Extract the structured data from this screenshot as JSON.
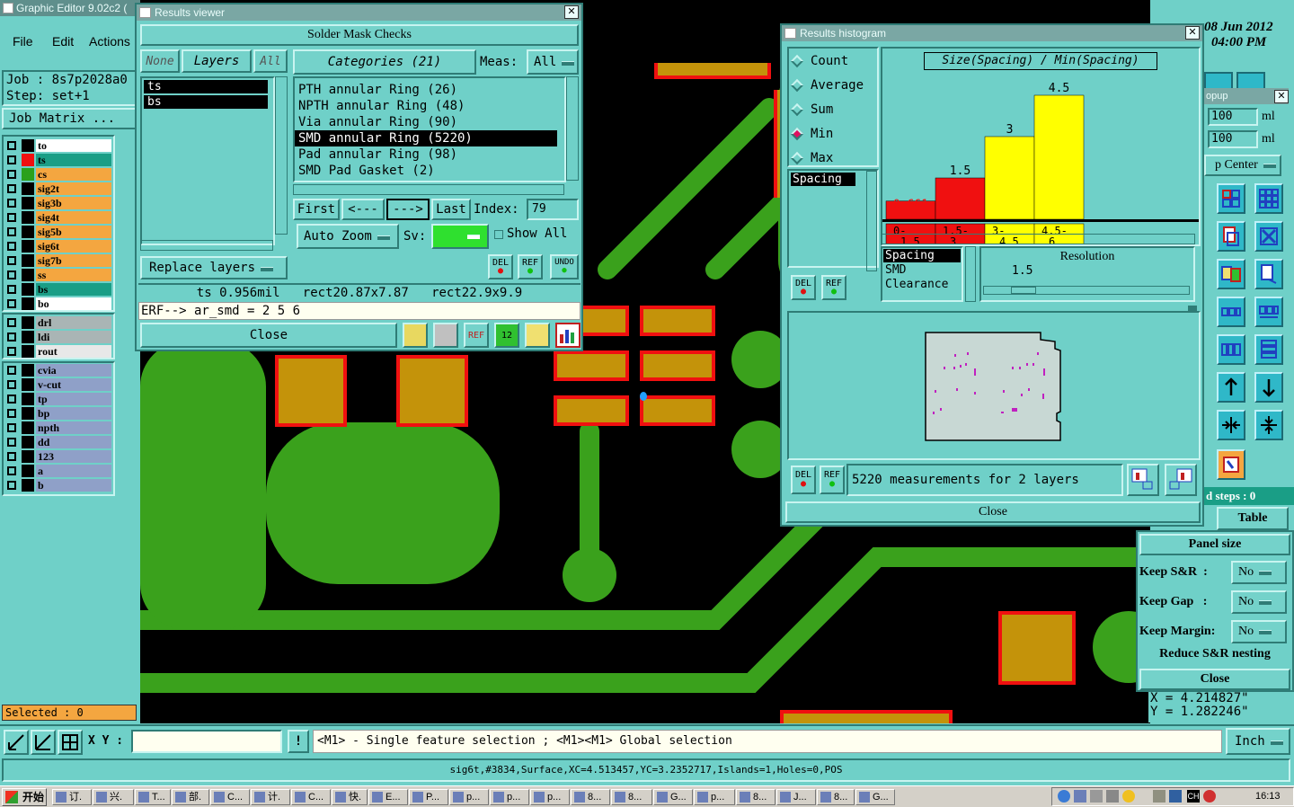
{
  "app": {
    "title": "Graphic Editor 9.02c2 (",
    "date": "08 Jun 2012",
    "time": "04:00 PM"
  },
  "menu": [
    "File",
    "Edit",
    "Actions"
  ],
  "job": {
    "job": "Job : 8s7p2028a0",
    "step": "Step: set+1",
    "matrix": "Job Matrix ..."
  },
  "layers": [
    {
      "name": "to",
      "color": "#ffffff",
      "swatch": "#000000"
    },
    {
      "name": "ts",
      "color": "#1a9e86",
      "swatch": "#f01010"
    },
    {
      "name": "cs",
      "color": "#f4a640",
      "swatch": "#2aa11c"
    },
    {
      "name": "sig2t",
      "color": "#f4a640",
      "swatch": "#000000"
    },
    {
      "name": "sig3b",
      "color": "#f4a640",
      "swatch": "#000000"
    },
    {
      "name": "sig4t",
      "color": "#f4a640",
      "swatch": "#000000"
    },
    {
      "name": "sig5b",
      "color": "#f4a640",
      "swatch": "#000000"
    },
    {
      "name": "sig6t",
      "color": "#f4a640",
      "swatch": "#000000"
    },
    {
      "name": "sig7b",
      "color": "#f4a640",
      "swatch": "#000000"
    },
    {
      "name": "ss",
      "color": "#f4a640",
      "swatch": "#000000"
    },
    {
      "name": "bs",
      "color": "#1a9e86",
      "swatch": "#000000"
    },
    {
      "name": "bo",
      "color": "#ffffff",
      "swatch": "#000000"
    }
  ],
  "layers2": [
    {
      "name": "drl",
      "color": "#a9b5b5"
    },
    {
      "name": "ldi",
      "color": "#a9b5b5"
    },
    {
      "name": "rout",
      "color": "#e8e8e8"
    }
  ],
  "layers3": [
    {
      "name": "cvia",
      "color": "#8fa0c8"
    },
    {
      "name": "v-cut",
      "color": "#8fa0c8"
    },
    {
      "name": "tp",
      "color": "#8fa0c8"
    },
    {
      "name": "bp",
      "color": "#8fa0c8"
    },
    {
      "name": "npth",
      "color": "#8fa0c8"
    },
    {
      "name": "dd",
      "color": "#8fa0c8"
    },
    {
      "name": "123",
      "color": "#8fa0c8"
    },
    {
      "name": "a",
      "color": "#8fa0c8"
    },
    {
      "name": "b",
      "color": "#8fa0c8"
    }
  ],
  "selected": "Selected : 0",
  "xy_label": "X Y :",
  "hint": "<M1> - Single feature selection ; <M1><M1> Global selection",
  "units": "Inch",
  "status": "sig6t,#3834,Surface,XC=4.513457,YC=3.2352717,Islands=1,Holes=0,POS",
  "results": {
    "title": "Results viewer",
    "header": "Solder Mask Checks",
    "tabs": [
      "None",
      "Layers",
      "All"
    ],
    "layers": [
      "ts",
      "bs"
    ],
    "categories_label": "Categories (21)",
    "meas_label": "Meas:",
    "meas_value": "All",
    "categories": [
      "PTH annular Ring (26)",
      "NPTH annular Ring (48)",
      "Via annular Ring (90)",
      "SMD annular Ring (5220)",
      "Pad annular Ring (98)",
      "SMD Pad Gasket (2)"
    ],
    "selected_category": 3,
    "nav": [
      "First",
      "<---",
      "--->",
      "Last"
    ],
    "index_label": "Index:",
    "index_value": "79",
    "autozoom": "Auto Zoom",
    "sv_label": "Sv:",
    "showall": "Show All",
    "replace": "Replace layers",
    "info": "ts 0.956mil   rect20.87x7.87   rect22.9x9.9",
    "erf": "ERF--> ar_smd = 2 5 6",
    "close": "Close",
    "del": "DEL",
    "ref": "REF",
    "undo": "UNDO"
  },
  "histogram": {
    "title": "Results histogram",
    "chart_title": "Size(Spacing) / Min(Spacing)",
    "modes": [
      "Count",
      "Average",
      "Sum",
      "Min",
      "Max"
    ],
    "selected_mode": 3,
    "list": [
      "Spacing"
    ],
    "list2": [
      "Spacing",
      "SMD",
      "Clearance"
    ],
    "resolution_label": "Resolution",
    "resolution_value": "1.5",
    "summary": "5220 measurements for 2 layers",
    "close": "Close",
    "del": "DEL",
    "ref": "REF"
  },
  "chart_data": {
    "type": "bar",
    "title": "Size(Spacing) / Min(Spacing)",
    "categories": [
      "0-1.5",
      "1.5-3",
      "3-4.5",
      "4.5-6"
    ],
    "values": [
      0.661,
      1.5,
      3,
      4.5
    ],
    "value_labels": [
      "0.661",
      "1.5",
      "3",
      "4.5"
    ],
    "colors": [
      "#f01010",
      "#f01010",
      "#ffff00",
      "#ffff00"
    ],
    "xlabel": "",
    "ylabel": ""
  },
  "popup": {
    "title": "opup",
    "val1": "100",
    "unit1": "ml",
    "val2": "100",
    "unit2": "ml",
    "center": "p Center",
    "steps": "d steps : 0",
    "table": "Table",
    "panel": "Panel size",
    "rows": [
      {
        "label": "Keep S&R  :",
        "value": "No"
      },
      {
        "label": "Keep Gap   :",
        "value": "No"
      },
      {
        "label": "Keep Margin:",
        "value": "No"
      }
    ],
    "reduce": "Reduce S&R nesting",
    "close": "Close",
    "x": "X = 4.214827\"",
    "y": "Y = 1.282246\""
  },
  "taskbar": {
    "start": "开始",
    "items": [
      "订.",
      "兴.",
      "T...",
      "部.",
      "C...",
      "计.",
      "C...",
      "快.",
      "E...",
      "P...",
      "p...",
      "p...",
      "p...",
      "8...",
      "8...",
      "G...",
      "p...",
      "8...",
      "J...",
      "8...",
      "G..."
    ],
    "clock": "16:13",
    "ime": "CH"
  }
}
